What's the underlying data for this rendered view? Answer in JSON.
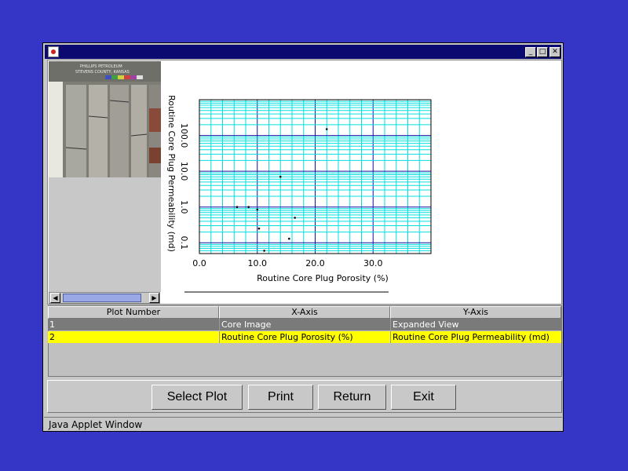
{
  "window": {
    "status_text": "Java Applet Window"
  },
  "photo": {
    "header_lines": [
      "PHILLIPS PETROLEUM",
      "STEVENS COUNTY, KANSAS"
    ]
  },
  "chart_data": {
    "type": "scatter",
    "xlabel": "Routine Core Plug Porosity (%)",
    "ylabel": "Routine Core Plug Permeability (md)",
    "x_ticks": [
      "0.0",
      "10.0",
      "20.0",
      "30.0"
    ],
    "y_ticks": [
      "0.1",
      "1.0",
      "10.0",
      "100.0"
    ],
    "xlim": [
      0,
      40
    ],
    "ylim": [
      0.05,
      1000
    ],
    "y_scale": "log",
    "grid": true,
    "points": [
      {
        "x": 6.5,
        "y": 1.0
      },
      {
        "x": 8.5,
        "y": 1.0
      },
      {
        "x": 10.0,
        "y": 0.85
      },
      {
        "x": 10.3,
        "y": 0.25
      },
      {
        "x": 11.2,
        "y": 0.06
      },
      {
        "x": 14.0,
        "y": 7.0
      },
      {
        "x": 15.5,
        "y": 0.13
      },
      {
        "x": 16.5,
        "y": 0.5
      },
      {
        "x": 22.0,
        "y": 150
      }
    ]
  },
  "table": {
    "headers": [
      "Plot Number",
      "X-Axis",
      "Y-Axis"
    ],
    "rows": [
      {
        "num": "1",
        "x": "Core Image",
        "y": "Expanded View",
        "selected": false
      },
      {
        "num": "2",
        "x": "Routine Core Plug Porosity (%)",
        "y": "Routine Core Plug Permeability (md)",
        "selected": true
      }
    ]
  },
  "buttons": {
    "select_plot": "Select Plot",
    "print": "Print",
    "return": "Return",
    "exit": "Exit"
  },
  "colors": {
    "desktop": "#3535c6",
    "grid": "#00e0e0",
    "major_grid": "#1010a0",
    "row_selected": "#ffff00",
    "row_normal": "#7a7a7a"
  }
}
